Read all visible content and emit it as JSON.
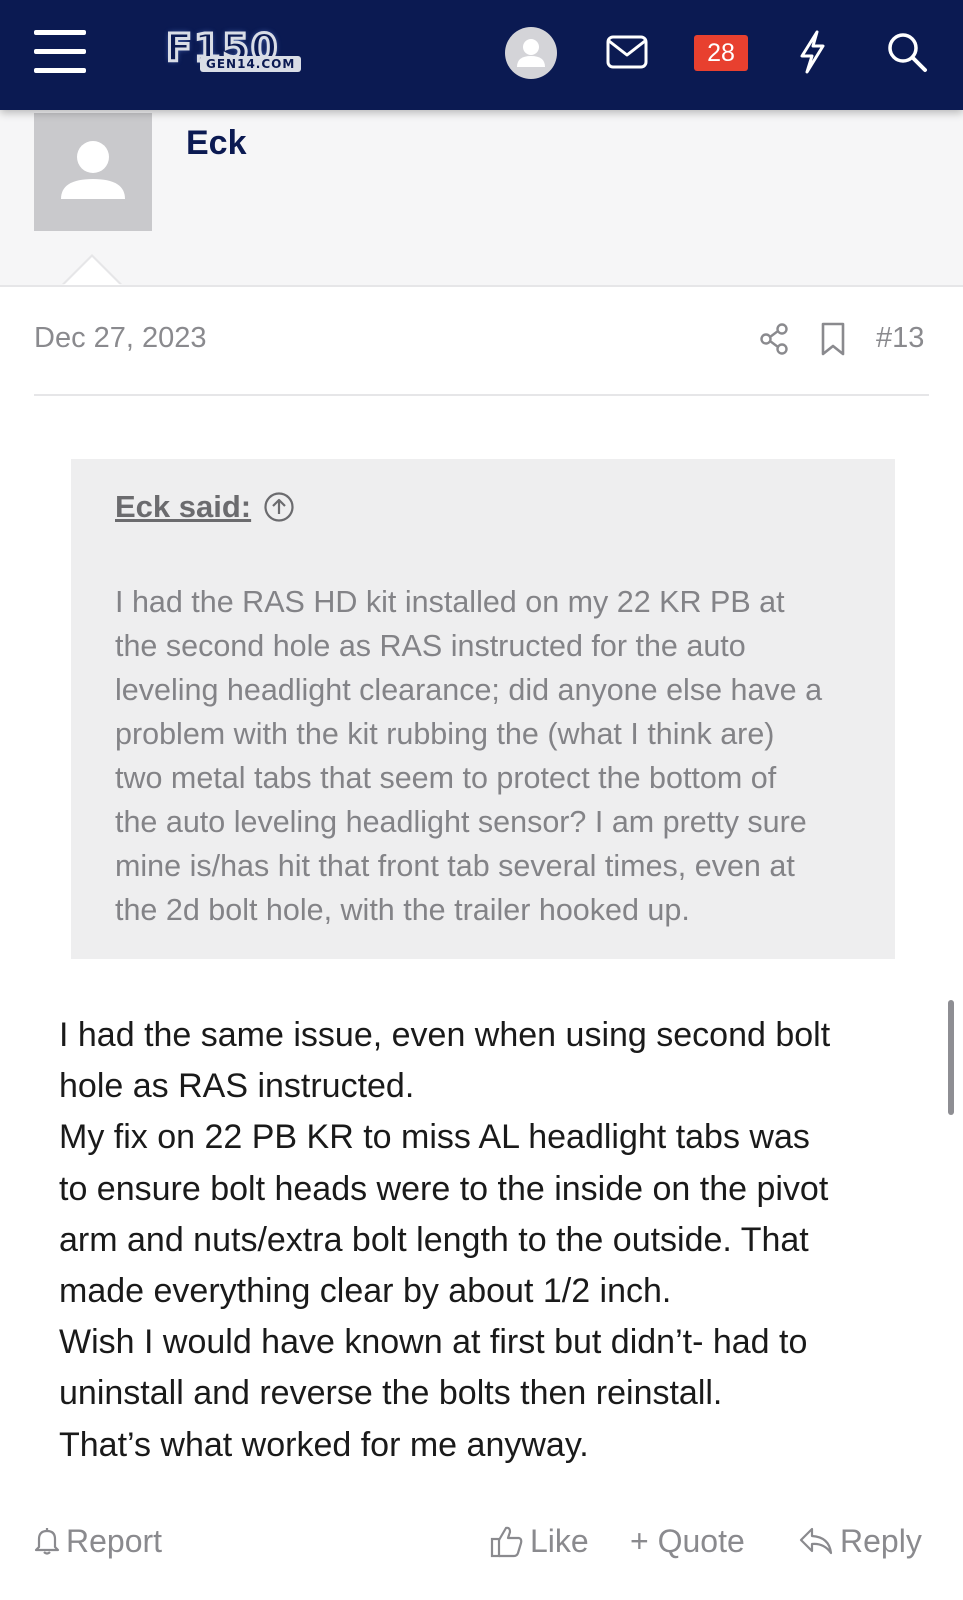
{
  "nav": {
    "logo_main": "F150",
    "logo_sub": "GEN14.COM",
    "alerts_count": "28",
    "icons": [
      "menu-icon",
      "user-icon",
      "mail-icon",
      "bolt-icon",
      "search-icon"
    ],
    "colors": {
      "bar": "#0b1a52",
      "badge": "#e8402f"
    }
  },
  "author": {
    "name": "Eck"
  },
  "post": {
    "date": "Dec 27, 2023",
    "number": "#13",
    "quote": {
      "author": "Eck said:",
      "lines": [
        "I had the RAS HD kit installed on my 22 KR PB at",
        "the second hole as RAS instructed for the auto",
        "leveling headlight clearance; did anyone else have a",
        "problem with the kit rubbing the (what I think are)",
        "two metal tabs that seem to protect the bottom of",
        "the auto leveling headlight sensor? I am pretty sure",
        "mine is/has hit that front tab several times, even at",
        "the 2d bolt hole, with the trailer hooked up."
      ]
    },
    "body_lines": [
      "I had the same issue, even when using second bolt",
      "hole as RAS instructed.",
      "My fix on 22 PB KR to miss AL headlight tabs was",
      "to ensure bolt heads were to the inside on the pivot",
      "arm and nuts/extra bolt length to the outside. That",
      "made everything clear by about 1/2 inch.",
      "Wish I would have known at first but didn’t- had to",
      "uninstall and reverse the bolts then reinstall.",
      "That’s what worked for me anyway."
    ]
  },
  "actions": {
    "report": "Report",
    "like": "Like",
    "quote": "+ Quote",
    "reply": "Reply"
  }
}
